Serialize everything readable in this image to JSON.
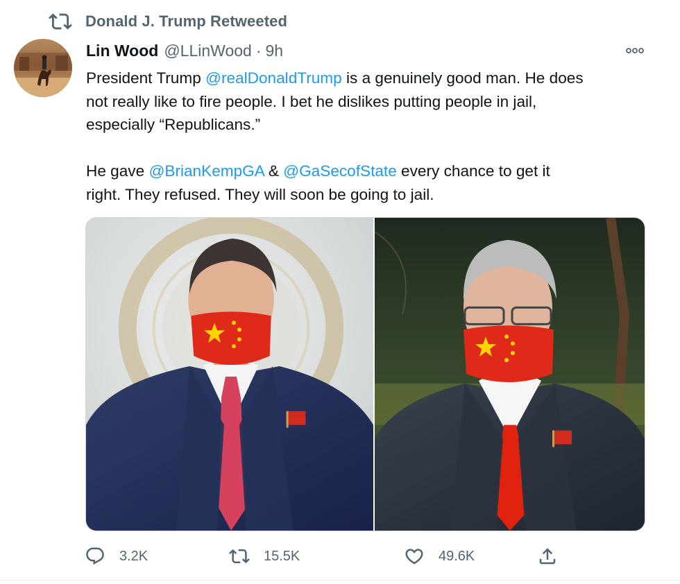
{
  "retweet_label": "Donald J. Trump Retweeted",
  "author": {
    "name": "Lin Wood",
    "handle": "@LLinWood",
    "separator": "·",
    "time": "9h"
  },
  "tweet": {
    "para1_line1": {
      "pre": "President Trump ",
      "mention": "@realDonaldTrump",
      "post": " is a genuinely good man. He does"
    },
    "para1_line2": "not really like to fire people. I bet he dislikes putting people in jail,",
    "para1_line3": "especially “Republicans.”",
    "para2_line1": {
      "pre": "He gave ",
      "mention1": "@BrianKempGA",
      "mid": " & ",
      "mention2": "@GaSecofState",
      "post": " every chance to get it"
    },
    "para2_line2": "right. They refused. They will soon be going to jail."
  },
  "actions": {
    "reply_count": "3.2K",
    "retweet_count": "15.5K",
    "like_count": "49.6K"
  },
  "icons": {
    "retweet": "retweet-icon",
    "more": "more-icon",
    "reply": "reply-icon",
    "like": "heart-icon",
    "share": "share-icon"
  },
  "colors": {
    "link": "#1d9bf0",
    "secondary": "#536471",
    "text": "#0f1419"
  }
}
